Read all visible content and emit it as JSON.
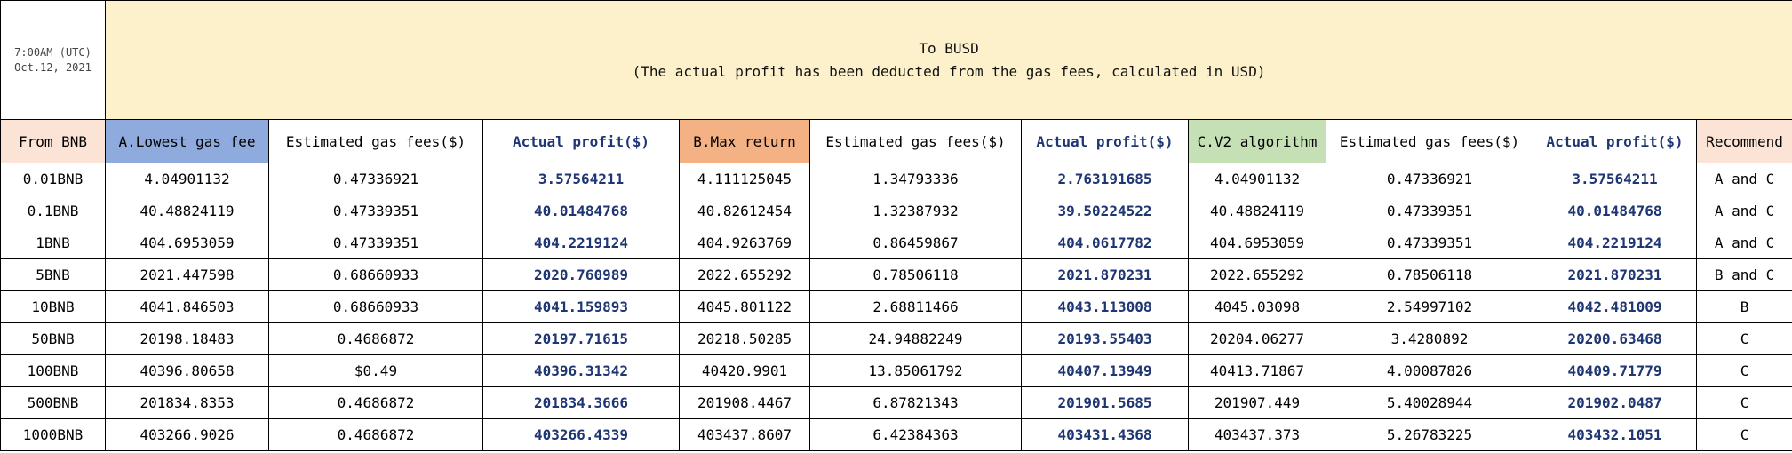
{
  "corner": {
    "time": "7:00AM (UTC)",
    "date": "Oct.12, 2021"
  },
  "banner": {
    "line1": "To BUSD",
    "line2": "(The actual profit has been deducted from the gas fees, calculated in USD)"
  },
  "headers": {
    "from": "From BNB",
    "a_name": "A.Lowest gas fee",
    "a_gas": "Estimated gas fees($)",
    "a_profit": "Actual profit($)",
    "b_name": "B.Max return",
    "b_gas": "Estimated gas fees($)",
    "b_profit": "Actual profit($)",
    "c_name": "C.V2 algorithm",
    "c_gas": "Estimated gas fees($)",
    "c_profit": "Actual profit($)",
    "recommend": "Recommend"
  },
  "rows": [
    [
      "0.01BNB",
      "4.04901132",
      "0.47336921",
      "3.57564211",
      "4.111125045",
      "1.34793336",
      "2.763191685",
      "4.04901132",
      "0.47336921",
      "3.57564211",
      "A and C"
    ],
    [
      "0.1BNB",
      "40.48824119",
      "0.47339351",
      "40.01484768",
      "40.82612454",
      "1.32387932",
      "39.50224522",
      "40.48824119",
      "0.47339351",
      "40.01484768",
      "A and C"
    ],
    [
      "1BNB",
      "404.6953059",
      "0.47339351",
      "404.2219124",
      "404.9263769",
      "0.86459867",
      "404.0617782",
      "404.6953059",
      "0.47339351",
      "404.2219124",
      "A and C"
    ],
    [
      "5BNB",
      "2021.447598",
      "0.68660933",
      "2020.760989",
      "2022.655292",
      "0.78506118",
      "2021.870231",
      "2022.655292",
      "0.78506118",
      "2021.870231",
      "B and C"
    ],
    [
      "10BNB",
      "4041.846503",
      "0.68660933",
      "4041.159893",
      "4045.801122",
      "2.68811466",
      "4043.113008",
      "4045.03098",
      "2.54997102",
      "4042.481009",
      "B"
    ],
    [
      "50BNB",
      "20198.18483",
      "0.4686872",
      "20197.71615",
      "20218.50285",
      "24.94882249",
      "20193.55403",
      "20204.06277",
      "3.4280892",
      "20200.63468",
      "C"
    ],
    [
      "100BNB",
      "40396.80658",
      "$0.49",
      "40396.31342",
      "40420.9901",
      "13.85061792",
      "40407.13949",
      "40413.71867",
      "4.00087826",
      "40409.71779",
      "C"
    ],
    [
      "500BNB",
      "201834.8353",
      "0.4686872",
      "201834.3666",
      "201908.4467",
      "6.87821343",
      "201901.5685",
      "201907.449",
      "5.40028944",
      "201902.0487",
      "C"
    ],
    [
      "1000BNB",
      "403266.9026",
      "0.4686872",
      "403266.4339",
      "403437.8607",
      "6.42384363",
      "403431.4368",
      "403437.373",
      "5.26783225",
      "403432.1051",
      "C"
    ]
  ]
}
